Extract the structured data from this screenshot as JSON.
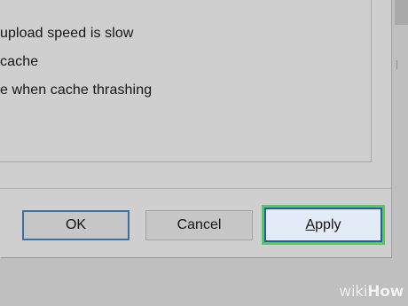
{
  "options": [
    "upload speed is slow",
    "cache",
    "e when cache thrashing"
  ],
  "buttons": {
    "ok": "OK",
    "cancel": "Cancel",
    "apply_prefix": "",
    "apply_underlined": "A",
    "apply_rest": "pply"
  },
  "watermark": {
    "prefix": "wiki",
    "suffix": "How"
  },
  "colors": {
    "dialog_bg": "#cfcfcf",
    "apply_bg": "#e3ecf6",
    "focus_border": "#1f5da8",
    "highlight": "#45d93d"
  }
}
